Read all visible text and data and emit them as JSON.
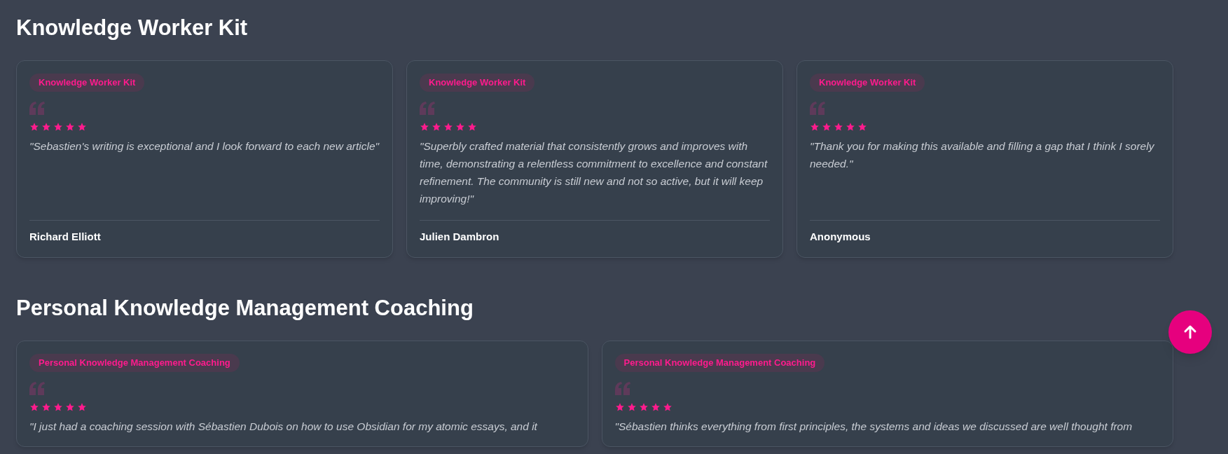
{
  "sections": [
    {
      "title": "Knowledge Worker Kit",
      "testimonials": [
        {
          "tag": "Knowledge Worker Kit",
          "stars": 5,
          "quote": "\"Sebastien's writing is exceptional and I look forward to each new article\"",
          "author": "Richard Elliott"
        },
        {
          "tag": "Knowledge Worker Kit",
          "stars": 5,
          "quote": "\"Superbly crafted material that consistently grows and improves with time, demonstrating a relentless commitment to excellence and constant refinement. The community is still new and not so active, but it will keep improving!\"",
          "author": "Julien Dambron"
        },
        {
          "tag": "Knowledge Worker Kit",
          "stars": 5,
          "quote": "\"Thank you for making this available and filling a gap that I think I sorely needed.\"",
          "author": "Anonymous"
        }
      ]
    },
    {
      "title": "Personal Knowledge Management Coaching",
      "testimonials": [
        {
          "tag": "Personal Knowledge Management Coaching",
          "stars": 5,
          "quote": "\"I just had a coaching session with Sébastien Dubois on how to use Obsidian for my atomic essays, and it"
        },
        {
          "tag": "Personal Knowledge Management Coaching",
          "stars": 5,
          "quote": "\"Sébastien thinks everything from first principles, the systems and ideas we discussed are well thought from"
        }
      ]
    }
  ]
}
